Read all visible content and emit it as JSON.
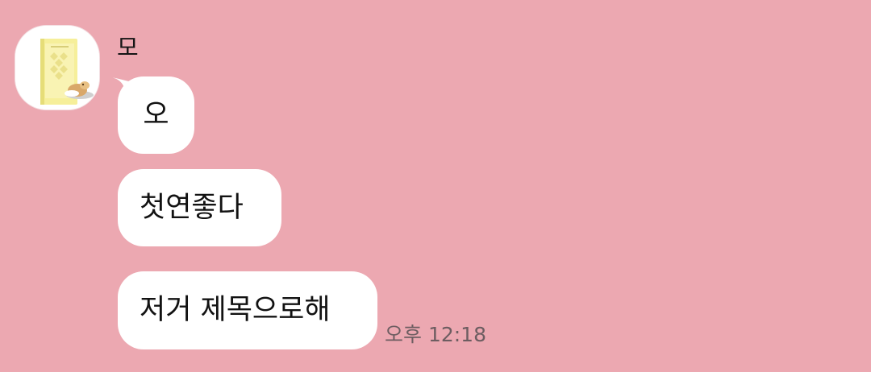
{
  "chat": {
    "background_color": "#eca8b1",
    "bubble_color": "#ffffff",
    "sender": {
      "name": "모",
      "avatar_icon": "profile-photo-yellow-book-with-figurine"
    },
    "messages": [
      {
        "text": "오"
      },
      {
        "text": "첫연좋다"
      },
      {
        "text": "저거 제목으로해"
      }
    ],
    "timestamp": "오후 12:18"
  }
}
